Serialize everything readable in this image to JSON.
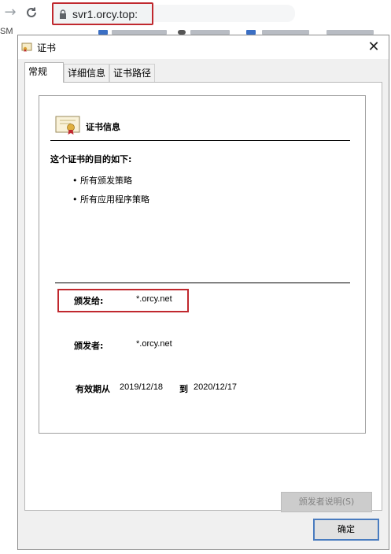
{
  "browser": {
    "address": "svr1.orcy.top:",
    "bookmark_fragment": "SM"
  },
  "dialog": {
    "title": "证书",
    "close_glyph": "✕",
    "tabs": [
      {
        "label": "常规"
      },
      {
        "label": "详细信息"
      },
      {
        "label": "证书路径"
      }
    ],
    "cert_info_heading": "证书信息",
    "purpose_title": "这个证书的目的如下:",
    "purposes": [
      "• 所有颁发策略",
      "• 所有应用程序策略"
    ],
    "issued_to_label": "颁发给:",
    "issued_to_value": "*.orcy.net",
    "issued_by_label": "颁发者:",
    "issued_by_value": "*.orcy.net",
    "valid_from_label": "有效期从",
    "valid_from": "2019/12/18",
    "valid_to_label": "到",
    "valid_to": "2020/12/17",
    "issuer_statement_button": "颁发者说明(S)",
    "ok_button": "确定"
  },
  "colors": {
    "highlight_red": "#c0282e",
    "ok_border": "#4a7cbf"
  }
}
